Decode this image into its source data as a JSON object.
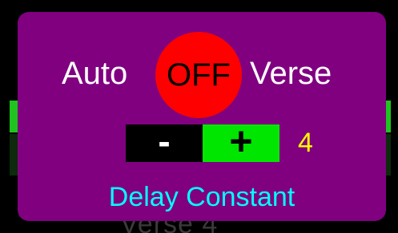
{
  "background": {
    "bottom_text": "Verse 4"
  },
  "popup": {
    "left_label": "Auto",
    "right_label": "Verse",
    "toggle_label": "OFF",
    "toggle_color": "#ff0000",
    "stepper": {
      "minus_label": "-",
      "plus_label": "+",
      "value": "4"
    },
    "caption": "Delay Constant",
    "colors": {
      "panel": "#800080",
      "caption": "#00ffff",
      "value": "#ffff00",
      "plus_button": "#00e600"
    }
  }
}
